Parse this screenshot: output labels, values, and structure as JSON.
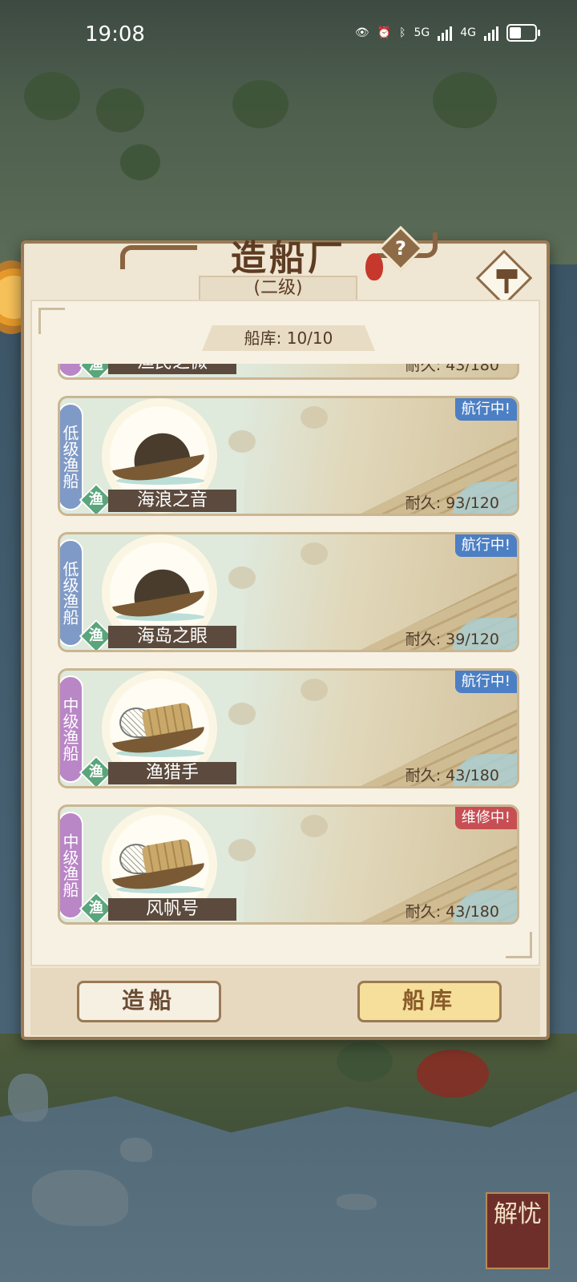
{
  "status_bar": {
    "time": "19:08",
    "net1": "5G",
    "net2": "4G"
  },
  "dialog": {
    "title": "造船厂",
    "level": "(二级)",
    "help_label": "?",
    "capacity": "船库: 10/10"
  },
  "partial_ship": {
    "name": "渔民之微",
    "durability": "耐久: 43/180"
  },
  "ships": [
    {
      "tag": "低级渔船",
      "tag_color": "#7f9ac6",
      "badge": "渔",
      "name": "海浪之音",
      "status": "航行中!",
      "status_color": "#4c7fc4",
      "durability": "耐久: 93/120",
      "boat": "low"
    },
    {
      "tag": "低级渔船",
      "tag_color": "#7f9ac6",
      "badge": "渔",
      "name": "海岛之眼",
      "status": "航行中!",
      "status_color": "#4c7fc4",
      "durability": "耐久: 39/120",
      "boat": "low"
    },
    {
      "tag": "中级渔船",
      "tag_color": "#b986c6",
      "badge": "渔",
      "name": "渔猎手",
      "status": "航行中!",
      "status_color": "#4c7fc4",
      "durability": "耐久: 43/180",
      "boat": "mid"
    },
    {
      "tag": "中级渔船",
      "tag_color": "#b986c6",
      "badge": "渔",
      "name": "风帆号",
      "status": "维修中!",
      "status_color": "#c74f54",
      "durability": "耐久: 43/180",
      "boat": "mid"
    }
  ],
  "buttons": {
    "build": "造船",
    "dock": "船库"
  },
  "side": {
    "jieyou": "解忧"
  }
}
